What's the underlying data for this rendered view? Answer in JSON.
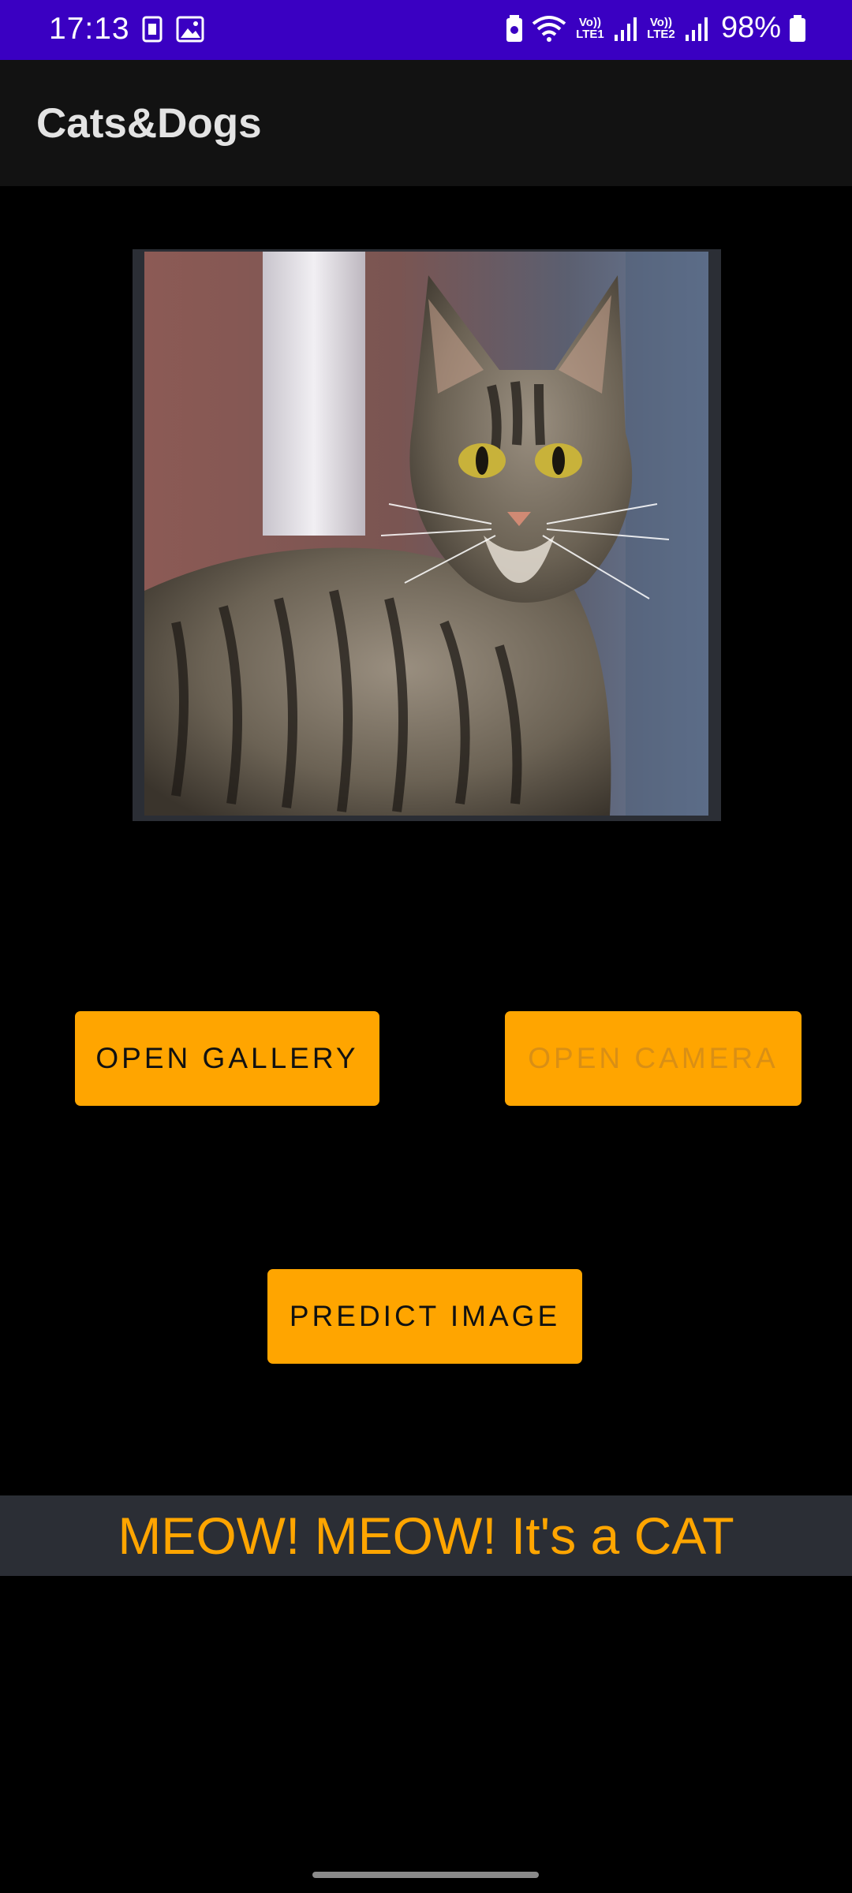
{
  "status_bar": {
    "time": "17:13",
    "net1": "Vo)) LTE1",
    "net2": "Vo)) LTE2",
    "battery": "98%"
  },
  "app_bar": {
    "title": "Cats&Dogs"
  },
  "buttons": {
    "gallery": "OPEN GALLERY",
    "camera": "OPEN CAMERA",
    "predict": "PREDICT IMAGE"
  },
  "result": {
    "text": "MEOW! MEOW! It's a CAT"
  },
  "colors": {
    "status_bar": "#3a00c2",
    "app_bar": "#121212",
    "accent": "#ffa500",
    "panel": "#2b2e35",
    "background": "#000000"
  },
  "icons": [
    "sim-card-icon",
    "gallery-icon",
    "battery-saver-icon",
    "wifi-icon",
    "signal-icon",
    "battery-icon"
  ]
}
